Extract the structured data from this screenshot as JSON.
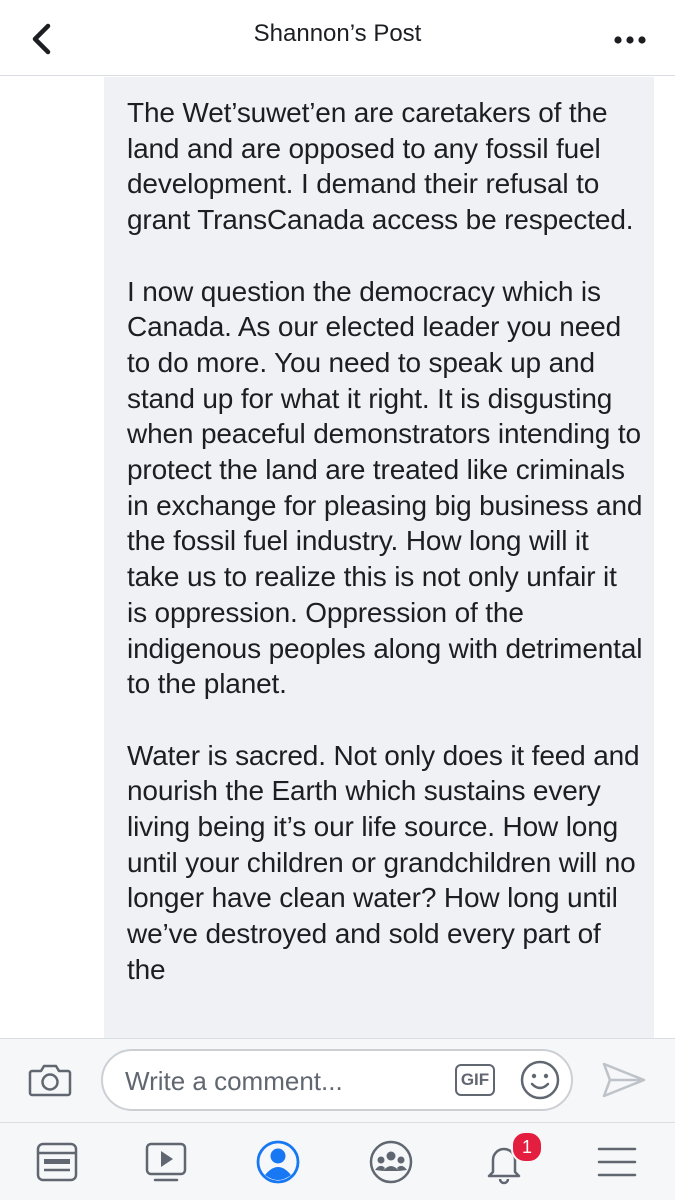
{
  "header": {
    "title": "Shannon’s Post"
  },
  "post": {
    "paragraphs": [
      "The Wet’suwet’en are caretakers of the land and are opposed to any fossil fuel development. I demand their refusal to grant TransCanada access be respected.",
      "I now question the democracy which is Canada. As our elected leader you need to do more. You need to speak up and stand up for what it right. It is disgusting when peaceful demonstrators intending to protect the land are treated like criminals in exchange for pleasing big business and the fossil fuel industry. How long will it take us to realize this is not only unfair it is oppression. Oppression of the indigenous peoples along with detrimental to the planet.",
      "Water is sacred. Not only does it feed and nourish the Earth which sustains every living being it’s our life source. How long until your children or grandchildren will no longer have clean water? How long until we’ve destroyed and sold every part of the"
    ]
  },
  "composer": {
    "placeholder": "Write a comment...",
    "gif_label": "GIF"
  },
  "tabbar": {
    "items": [
      {
        "icon": "news-feed-icon"
      },
      {
        "icon": "watch-icon"
      },
      {
        "icon": "profile-icon",
        "active": true
      },
      {
        "icon": "groups-icon"
      },
      {
        "icon": "notifications-icon",
        "badge": "1"
      },
      {
        "icon": "menu-icon"
      }
    ]
  },
  "colors": {
    "accent": "#1877f2",
    "icon_gray": "#606770",
    "bubble_bg": "#f0f1f4",
    "badge_red": "#e41e3f"
  }
}
